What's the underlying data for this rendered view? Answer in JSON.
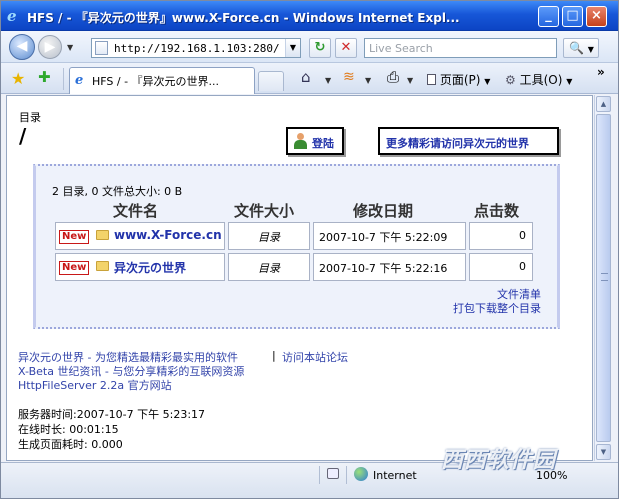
{
  "window": {
    "title": "HFS / - 『异次元の世界』www.X-Force.cn - Windows Internet Expl...",
    "minimize_glyph": "_",
    "maximize_glyph": "□",
    "close_glyph": "×"
  },
  "nav": {
    "back_glyph": "◀",
    "forward_glyph": "▶",
    "address": "http://192.168.1.103:280/",
    "refresh_glyph": "↻",
    "stop_glyph": "✕",
    "search_placeholder": "Live Search",
    "search_glyph": "🔍"
  },
  "tabs": {
    "active_title": "HFS / - 『异次元の世界...",
    "favorites_glyph": "★",
    "add_favorite_glyph": "✚"
  },
  "toolbar": {
    "home_glyph": "⌂",
    "feeds_glyph": "≋",
    "print_glyph": "⎙",
    "page_label": "页面(P)",
    "tools_label": "工具(O)",
    "more_glyph": "»"
  },
  "page": {
    "dir_label": "目录",
    "current_path": "/",
    "login_label": "登陆",
    "more_link": "更多精彩请访问异次元的世界",
    "summary": "2 目录, 0 文件总大小: 0 B",
    "columns": [
      "文件名",
      "文件大小",
      "修改日期",
      "点击数"
    ],
    "rows": [
      {
        "badge": "New",
        "name": "www.X-Force.cn",
        "size": "目录",
        "modified": "2007-10-7 下午  5:22:09",
        "hits": "0"
      },
      {
        "badge": "New",
        "name": "异次元の世界",
        "size": "目录",
        "modified": "2007-10-7 下午  5:22:16",
        "hits": "0"
      }
    ],
    "file_list_link": "文件清单",
    "download_all_link": "打包下载整个目录",
    "footer_links": [
      "异次元の世界 - 为您精选最精彩最实用的软件",
      "|",
      "访问本站论坛",
      "X-Beta 世纪资讯 - 与您分享精彩的互联网资源",
      "HttpFileServer 2.2a 官方网站"
    ],
    "server_time": "服务器时间:2007-10-7 下午  5:23:17",
    "uptime": "在线时长: 00:01:15",
    "render_time": "生成页面耗时: 0.000"
  },
  "status": {
    "zone": "Internet",
    "zoom": "100%",
    "watermark": "西西软件园"
  }
}
